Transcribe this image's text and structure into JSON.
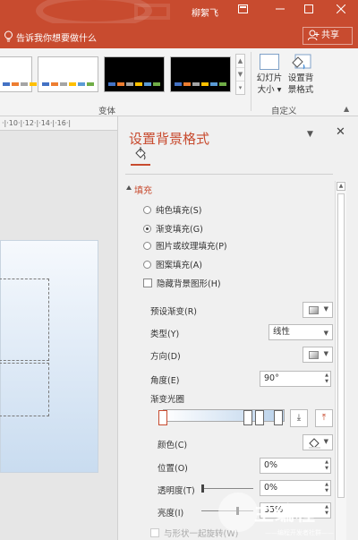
{
  "titlebar": {
    "user_name": "柳絮飞",
    "color": "#c84b2f"
  },
  "tellbar": {
    "tell_me_text": "告诉我你想要做什么",
    "share_label": "共享"
  },
  "ribbon": {
    "variants_group_label": "变体",
    "customize_group_label": "自定义",
    "slide_size_label_1": "幻灯片",
    "slide_size_label_2": "大小",
    "format_bg_label_1": "设置背",
    "format_bg_label_2": "景格式",
    "variant_thumbnails": [
      {
        "background": "#ffffff",
        "bars": [
          "#4472c4",
          "#ed7d31",
          "#a5a5a5",
          "#ffc000",
          "#5b9bd5",
          "#70ad47"
        ]
      },
      {
        "background": "#ffffff",
        "bars": [
          "#4472c4",
          "#ed7d31",
          "#a5a5a5",
          "#ffc000",
          "#5b9bd5",
          "#70ad47"
        ]
      },
      {
        "background": "#000000",
        "bars": [
          "#4472c4",
          "#ed7d31",
          "#a5a5a5",
          "#ffc000",
          "#5b9bd5",
          "#70ad47"
        ]
      },
      {
        "background": "#000000",
        "bars": [
          "#4472c4",
          "#ed7d31",
          "#a5a5a5",
          "#ffc000",
          "#5b9bd5",
          "#70ad47"
        ]
      }
    ]
  },
  "ruler": {
    "text": "·|·10·|·12·|·14·|·16·|"
  },
  "pane": {
    "title": "设置背景格式",
    "section_fill": "填充",
    "fill_options": [
      {
        "label": "纯色填充(S)",
        "selected": false
      },
      {
        "label": "渐变填充(G)",
        "selected": true
      },
      {
        "label": "图片或纹理填充(P)",
        "selected": false
      },
      {
        "label": "图案填充(A)",
        "selected": false
      }
    ],
    "hide_bg_graphics_label": "隐藏背景图形(H)",
    "preset_gradient_label": "预设渐变(R)",
    "type_label": "类型(Y)",
    "type_value": "线性",
    "direction_label": "方向(D)",
    "angle_label": "角度(E)",
    "angle_value": "90°",
    "gradient_stops_label": "渐变光圈",
    "color_label": "颜色(C)",
    "position_label": "位置(O)",
    "position_value": "0%",
    "transparency_label": "透明度(T)",
    "transparency_value": "0%",
    "brightness_label": "亮度(I)",
    "brightness_value": "35%",
    "rotate_with_shape_label": "与形状一起旋转(W)",
    "accent_color": "#c84b2f"
  },
  "watermark": {
    "text": "主编程",
    "subtext": "——编程开发者社群——"
  }
}
